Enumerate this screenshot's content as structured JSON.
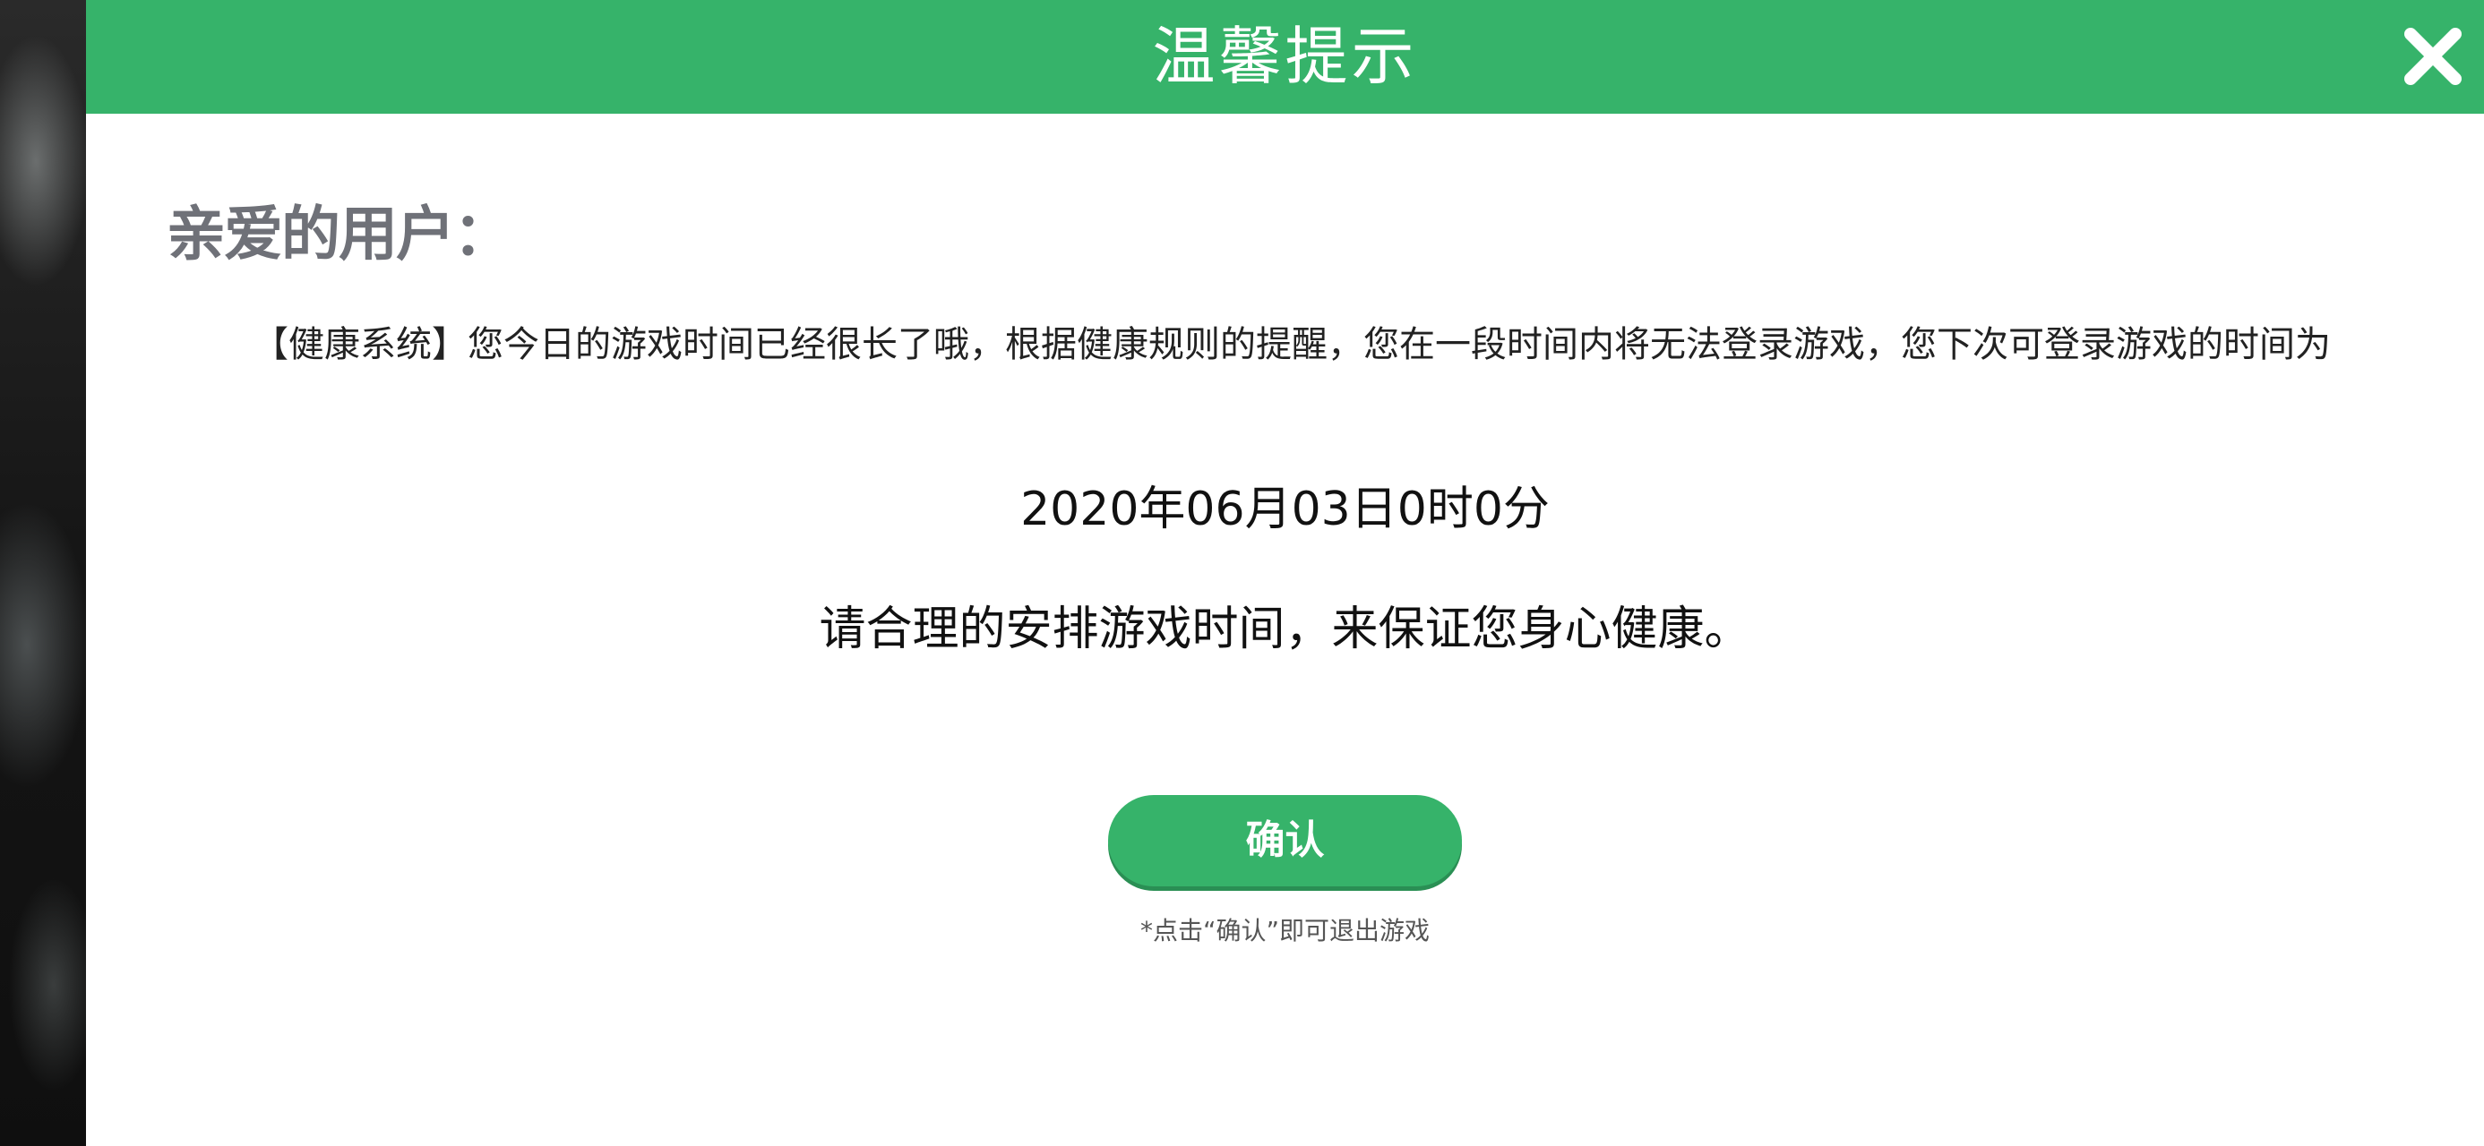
{
  "dialog": {
    "title": "温馨提示",
    "greeting": "亲爱的用户：",
    "message": "【健康系统】您今日的游戏时间已经很长了哦，根据健康规则的提醒，您在一段时间内将无法登录游戏，您下次可登录游戏的时间为",
    "next_login_time": "2020年06月03日0时0分",
    "advice": "请合理的安排游戏时间，来保证您身心健康。",
    "confirm_label": "确认",
    "footnote": "*点击“确认”即可退出游戏",
    "close_icon": "close-icon"
  },
  "colors": {
    "accent": "#36b36a",
    "greeting_text": "#6f7178",
    "body_text": "#222222"
  }
}
